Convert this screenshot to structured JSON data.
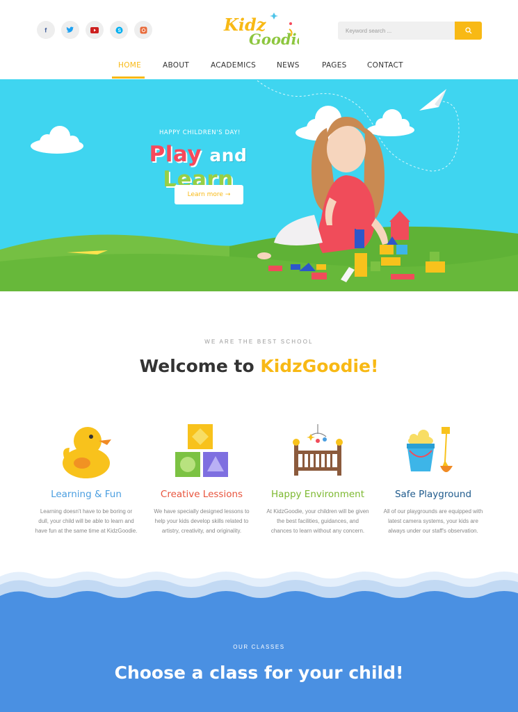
{
  "header": {
    "social": [
      "facebook-icon",
      "twitter-icon",
      "youtube-icon",
      "skype-icon",
      "instagram-icon"
    ],
    "logo": {
      "line1": "Kidz",
      "line2": "Goodie"
    },
    "search": {
      "placeholder": "Keyword search ..."
    }
  },
  "nav": {
    "items": [
      {
        "label": "HOME",
        "active": true
      },
      {
        "label": "ABOUT"
      },
      {
        "label": "ACADEMICS"
      },
      {
        "label": "NEWS"
      },
      {
        "label": "PAGES"
      },
      {
        "label": "CONTACT"
      }
    ]
  },
  "hero": {
    "kicker": "HAPPY CHILDREN'S DAY!",
    "title": {
      "w1": "Play",
      "w2": "and",
      "w3": "Learn"
    },
    "button": "Learn more →"
  },
  "welcome": {
    "kicker": "WE ARE THE BEST SCHOOL",
    "title": "Welcome to ",
    "brand": "KidzGoodie!"
  },
  "features": [
    {
      "title": "Learning & Fun",
      "color": "#4a9ee0",
      "icon": "duck-icon",
      "text": "Learning doesn't have to be boring or dull, your child will be able to learn and have fun at the same time at KidzGoodie."
    },
    {
      "title": "Creative Lessions",
      "color": "#e8543d",
      "icon": "blocks-icon",
      "text": "We have specially designed lessons to help your kids develop skills related to artistry, creativity, and originality."
    },
    {
      "title": "Happy Environment",
      "color": "#7cb82f",
      "icon": "crib-icon",
      "text": "At KidzGoodie, your children will be given the best facilities, guidances, and chances to learn without any concern."
    },
    {
      "title": "Safe Playground",
      "color": "#1e5a8c",
      "icon": "bucket-spade-icon",
      "text": "All of our playgrounds are equipped with latest camera systems, your kids are always under our staff's observation."
    }
  ],
  "classes": {
    "kicker": "OUR CLASSES",
    "title": "Choose a class for your child!"
  },
  "colors": {
    "accent": "#f8b915",
    "hero_bg": "#3fd5f0",
    "classes_bg": "#4a90e2",
    "grass": "#6cbd3a"
  }
}
